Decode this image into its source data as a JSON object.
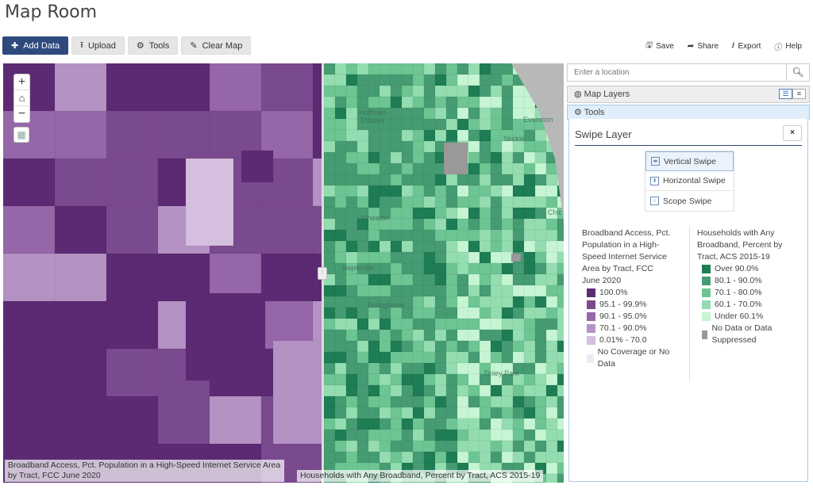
{
  "app": {
    "title": "Map Room"
  },
  "toolbar": {
    "add_data": "Add Data",
    "upload": "Upload",
    "tools": "Tools",
    "clear_map": "Clear Map"
  },
  "top_actions": {
    "save": "Save",
    "share": "Share",
    "export": "Export",
    "help": "Help"
  },
  "search": {
    "placeholder": "Enter a location"
  },
  "panels": {
    "map_layers": "Map Layers",
    "tools": "Tools"
  },
  "swipe": {
    "title": "Swipe Layer",
    "close": "×",
    "options": [
      "Vertical Swipe",
      "Horizontal Swipe",
      "Scope Swipe"
    ],
    "selected": "Vertical Swipe"
  },
  "map": {
    "labels": [
      "Hoffman Estates",
      "Evanston",
      "Skokie",
      "Chic",
      "Wheaton",
      "Naperville",
      "Bolingbrook",
      "Tinley Park"
    ],
    "left_caption": "Broadband Access, Pct. Population in a High-Speed Internet Service Area by Tract, FCC June 2020",
    "right_caption": "Households with Any Broadband, Percent by Tract, ACS 2015-19"
  },
  "legend_left": {
    "title": "Broadband Access, Pct. Population in a High-Speed Internet Service Area by Tract, FCC June 2020",
    "items": [
      {
        "label": "100.0%",
        "color": "#5c2a72"
      },
      {
        "label": "95.1 - 99.9%",
        "color": "#7a4a8e"
      },
      {
        "label": "90.1 - 95.0%",
        "color": "#9567a8"
      },
      {
        "label": "70.1 - 90.0%",
        "color": "#b592c4"
      },
      {
        "label": "0.01% - 70.0",
        "color": "#d5bfdf"
      },
      {
        "label": "No Coverage or No Data",
        "color": "#f3e8f6"
      }
    ]
  },
  "legend_right": {
    "title": "Households with Any Broadband, Percent by Tract, ACS 2015-19",
    "items": [
      {
        "label": "Over 90.0%",
        "color": "#1e7d55"
      },
      {
        "label": "80.1 - 90.0%",
        "color": "#469c72"
      },
      {
        "label": "70.1 - 80.0%",
        "color": "#6cc592"
      },
      {
        "label": "60.1 - 70.0%",
        "color": "#94ddb0"
      },
      {
        "label": "Under 60.1%",
        "color": "#c5f5d3"
      },
      {
        "label": "No Data or Data Suppressed",
        "color": "#999999"
      }
    ]
  }
}
